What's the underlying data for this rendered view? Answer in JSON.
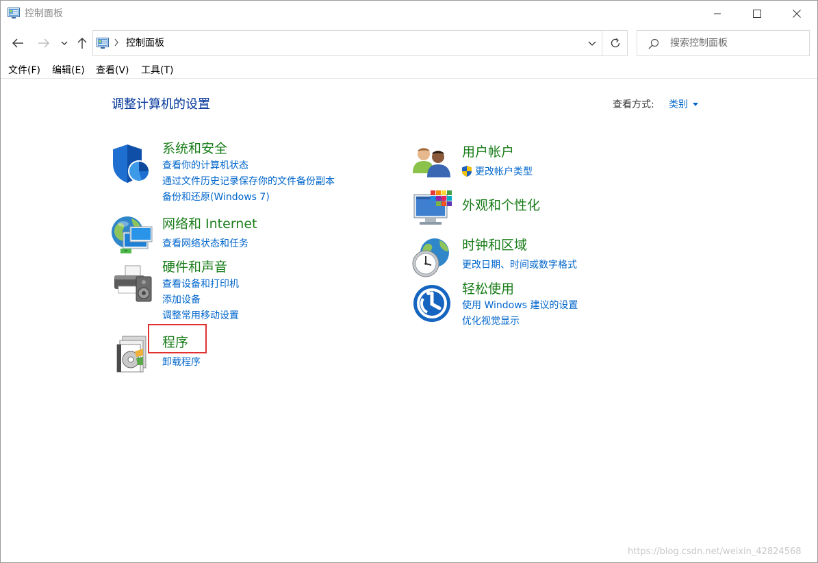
{
  "window": {
    "title": "控制面板"
  },
  "nav": {
    "breadcrumb": "控制面板",
    "search_placeholder": "搜索控制面板"
  },
  "menu": {
    "file": "文件(F)",
    "edit": "编辑(E)",
    "view": "查看(V)",
    "tools": "工具(T)"
  },
  "content": {
    "title": "调整计算机的设置",
    "view_by_label": "查看方式:",
    "view_by_value": "类别"
  },
  "categories": {
    "system_security": {
      "title": "系统和安全",
      "links": [
        "查看你的计算机状态",
        "通过文件历史记录保存你的文件备份副本",
        "备份和还原(Windows 7)"
      ]
    },
    "network": {
      "title": "网络和 Internet",
      "links": [
        "查看网络状态和任务"
      ]
    },
    "hardware": {
      "title": "硬件和声音",
      "links": [
        "查看设备和打印机",
        "添加设备",
        "调整常用移动设置"
      ]
    },
    "programs": {
      "title": "程序",
      "links": [
        "卸载程序"
      ]
    },
    "user_accounts": {
      "title": "用户帐户",
      "links": [
        "更改帐户类型"
      ]
    },
    "appearance": {
      "title": "外观和个性化",
      "links": []
    },
    "clock_region": {
      "title": "时钟和区域",
      "links": [
        "更改日期、时间或数字格式"
      ]
    },
    "ease_of_access": {
      "title": "轻松使用",
      "links": [
        "使用 Windows 建议的设置",
        "优化视觉显示"
      ]
    }
  },
  "watermark": "https://blog.csdn.net/weixin_42824568",
  "colors": {
    "category_title": "#1a7d1a",
    "link": "#0066cc",
    "page_title": "#003399",
    "highlight": "#e03030"
  }
}
